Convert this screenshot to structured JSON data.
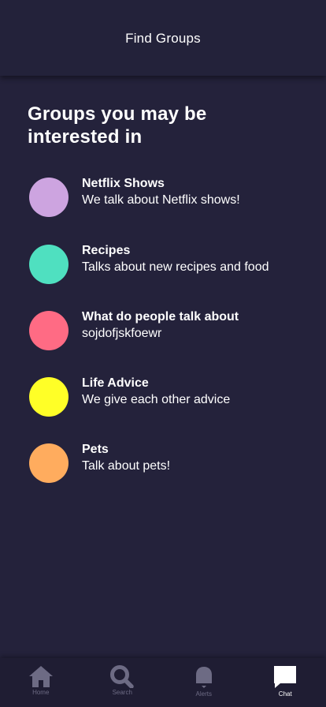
{
  "header": {
    "title": "Find Groups"
  },
  "section": {
    "title": "Groups you may be interested in"
  },
  "groups": [
    {
      "name": "Netflix Shows",
      "description": "We talk about Netflix shows!",
      "color": "#cda4e0"
    },
    {
      "name": "Recipes",
      "description": "Talks about new recipes and food",
      "color": "#4fe0c0"
    },
    {
      "name": "What do people talk about",
      "description": "sojdofjskfoewr",
      "color": "#ff6b84"
    },
    {
      "name": "Life Advice",
      "description": "We give each other advice",
      "color": "#ffff27"
    },
    {
      "name": "Pets",
      "description": "Talk about pets!",
      "color": "#ffac5e"
    }
  ],
  "tabbar": {
    "items": [
      {
        "label": "Home",
        "icon": "home-icon",
        "active": false
      },
      {
        "label": "Search",
        "icon": "search-icon",
        "active": false
      },
      {
        "label": "Alerts",
        "icon": "bell-icon",
        "active": false
      },
      {
        "label": "Chat",
        "icon": "chat-bubble-icon",
        "active": true
      }
    ]
  },
  "colors": {
    "background": "#24223b",
    "header": "#23223a",
    "tabbar": "#1f1d33",
    "tab_inactive": "#6d6b84",
    "tab_active": "#ffffff"
  }
}
